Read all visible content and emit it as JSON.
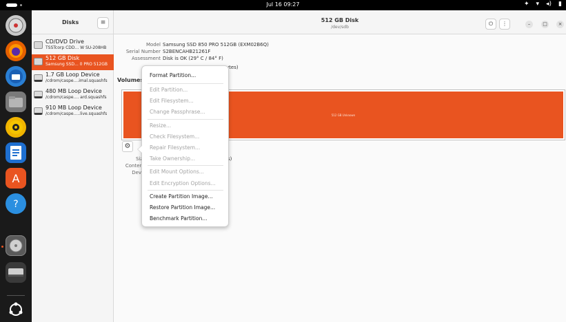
{
  "topbar": {
    "clock": "Jul 16 09:27"
  },
  "sidebar": {
    "title": "Disks",
    "menu_label": "≡",
    "disks": [
      {
        "name": "CD/DVD Drive",
        "sub": "TSSTcorp CDD... W SU-208HB",
        "selected": false,
        "icon": "optical-drive-icon"
      },
      {
        "name": "512 GB Disk",
        "sub": "Samsung SSD... 0 PRO 512GB",
        "selected": true,
        "icon": "hard-disk-icon"
      },
      {
        "name": "1.7 GB Loop Device",
        "sub": "/cdrom/caspe....imal.squashfs",
        "selected": false,
        "icon": "loop-device-icon"
      },
      {
        "name": "480 MB Loop Device",
        "sub": "/cdrom/caspe.... ard.squashfs",
        "selected": false,
        "icon": "loop-device-icon"
      },
      {
        "name": "910 MB Loop Device",
        "sub": "/cdrom/caspe.....live.squashfs",
        "selected": false,
        "icon": "loop-device-icon"
      }
    ]
  },
  "header": {
    "title": "512 GB Disk",
    "subtitle": "/dev/sdb",
    "power_icon": "⏻",
    "menu_icon": "⋮",
    "minimize_icon": "–",
    "maximize_icon": "□",
    "close_icon": "×"
  },
  "info": {
    "model_label": "Model",
    "model_value": "Samsung SSD 850 PRO 512GB (EXM02B6Q)",
    "serial_label": "Serial Number",
    "serial_value": "S2BENCAHB21261F",
    "assessment_label": "Assessment",
    "assessment_value": "Disk is OK (29° C / 84° F)",
    "bytes_tail": "ytes)"
  },
  "volumes": {
    "title": "Volumes",
    "bar_label": "512 GB Unknown",
    "accent": "#e95420"
  },
  "props": {
    "size_label": "Siz",
    "contents_label": "Conten",
    "device_label": "Devi",
    "size_tail": "s)"
  },
  "popup_menu": {
    "items": [
      {
        "label": "Format Partition...",
        "disabled": false
      },
      {
        "label": "Edit Partition...",
        "disabled": true
      },
      {
        "label": "Edit Filesystem...",
        "disabled": true
      },
      {
        "label": "Change Passphrase...",
        "disabled": true
      },
      {
        "label": "Resize...",
        "disabled": true
      },
      {
        "label": "Check Filesystem...",
        "disabled": true
      },
      {
        "label": "Repair Filesystem...",
        "disabled": true
      },
      {
        "label": "Take Ownership...",
        "disabled": true
      },
      {
        "label": "Edit Mount Options...",
        "disabled": true
      },
      {
        "label": "Edit Encryption Options...",
        "disabled": true
      },
      {
        "label": "Create Partition Image...",
        "disabled": false
      },
      {
        "label": "Restore Partition Image...",
        "disabled": false
      },
      {
        "label": "Benchmark Partition...",
        "disabled": false
      }
    ]
  },
  "dock": {
    "apps": [
      {
        "name": "disks-app-icon",
        "color": "#c33"
      },
      {
        "name": "firefox-icon",
        "color": "#e66000"
      },
      {
        "name": "thunderbird-icon",
        "color": "#2a7fd4"
      },
      {
        "name": "files-icon",
        "color": "#7a7a7a"
      },
      {
        "name": "rhythmbox-icon",
        "color": "#f0b400"
      },
      {
        "name": "writer-icon",
        "color": "#1e6fd0"
      },
      {
        "name": "app-center-icon",
        "color": "#e95420"
      },
      {
        "name": "help-icon",
        "color": "#2b8fe0"
      },
      {
        "name": "disks-utility-icon",
        "color": "#888"
      },
      {
        "name": "drive-icon",
        "color": "#9a9a9a"
      },
      {
        "name": "show-apps-icon",
        "color": "#1a1a1a"
      }
    ]
  }
}
